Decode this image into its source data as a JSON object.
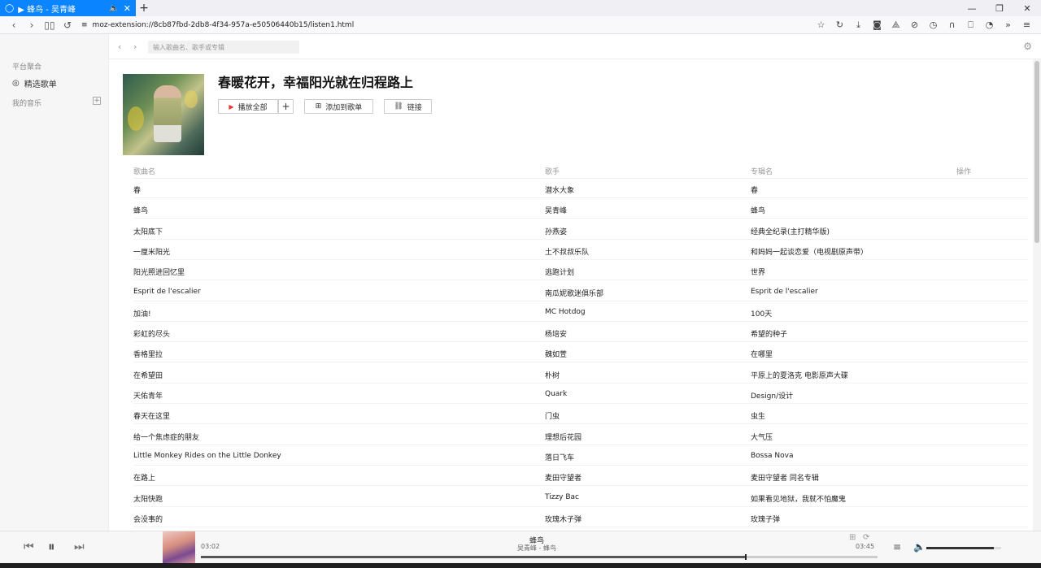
{
  "browser": {
    "tab_title": "▶ 蜂鸟 - 吴青峰",
    "tab_audio_icon": "speaker-icon",
    "new_tab": "+",
    "url": "moz-extension://8cb87fbd-2db8-4f34-957a-e50506440b15/listen1.html",
    "window_controls": [
      "—",
      "❐",
      "✕"
    ]
  },
  "sidebar": {
    "section_platform": "平台聚合",
    "featured_playlists": "精选歌单",
    "section_my_music": "我的音乐",
    "add": "+"
  },
  "topbar": {
    "search_placeholder": "输入歌曲名、歌手或专辑"
  },
  "playlist": {
    "title": "春暖花开，幸福阳光就在归程路上",
    "play_all": "播放全部",
    "add": "+",
    "add_to_playlist": "添加到歌单",
    "link": "链接"
  },
  "table": {
    "headers": {
      "song": "歌曲名",
      "artist": "歌手",
      "album": "专辑名",
      "actions": "操作"
    },
    "rows": [
      {
        "song": "春",
        "artist": "潜水大象",
        "album": "春"
      },
      {
        "song": "蜂鸟",
        "artist": "吴青峰",
        "album": "蜂鸟"
      },
      {
        "song": "太阳底下",
        "artist": "孙燕姿",
        "album": "经典全纪录(主打精华版)"
      },
      {
        "song": "一厘米阳光",
        "artist": "土不叔叔乐队",
        "album": "和妈妈一起谈恋爱（电视剧原声带）"
      },
      {
        "song": "阳光照进回忆里",
        "artist": "逃跑计划",
        "album": "世界"
      },
      {
        "song": "Esprit de l'escalier",
        "artist": "南瓜妮歌迷俱乐部",
        "album": "Esprit de l'escalier"
      },
      {
        "song": "加油!",
        "artist": "MC Hotdog",
        "album": "100天"
      },
      {
        "song": "彩虹的尽头",
        "artist": "杨培安",
        "album": "希望的种子"
      },
      {
        "song": "香格里拉",
        "artist": "魏如萱",
        "album": "在哪里"
      },
      {
        "song": "在希望田",
        "artist": "朴树",
        "album": "平原上的夏洛克 电影原声大碟"
      },
      {
        "song": "天佑青年",
        "artist": "Quark",
        "album": "Design/设计"
      },
      {
        "song": "春天在这里",
        "artist": "门虫",
        "album": "虫生"
      },
      {
        "song": "给一个焦虑症的朋友",
        "artist": "理想后花园",
        "album": "大气压"
      },
      {
        "song": "Little Monkey Rides on the Little Donkey",
        "artist": "落日飞车",
        "album": "Bossa Nova"
      },
      {
        "song": "在路上",
        "artist": "麦田守望者",
        "album": "麦田守望者 同名专辑"
      },
      {
        "song": "太阳快跑",
        "artist": "Tizzy Bac",
        "album": "如果看见地狱，我就不怕魔鬼"
      },
      {
        "song": "会没事的",
        "artist": "玫瑰木子弹",
        "album": "玫瑰子弹"
      }
    ]
  },
  "player": {
    "song": "蜂鸟",
    "artist_album": "吴青峰 - 蜂鸟",
    "current_time": "03:02",
    "total_time": "03:45",
    "progress": 0.804,
    "volume": 0.9
  },
  "colors": {
    "tab_active": "#0a84ff",
    "play_accent": "#e33333"
  }
}
